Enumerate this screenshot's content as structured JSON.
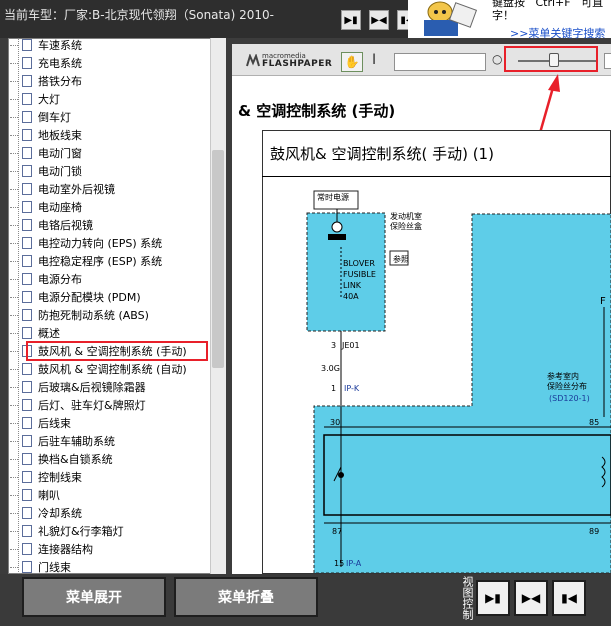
{
  "header": {
    "car_label": "当前车型：厂家:B-北京现代领翔（Sonata) 2010-",
    "nav_buttons": [
      "▶▮",
      "▶◀",
      "▮◀"
    ]
  },
  "notice": {
    "text": "键盘按   Ctrl+F   可直\n字！",
    "link": ">>菜单关键字搜索"
  },
  "tree": {
    "items": [
      "车速系统",
      "充电系统",
      "搭铁分布",
      "大灯",
      "倒车灯",
      "地板线束",
      "电动门窗",
      "电动门锁",
      "电动室外后视镜",
      "电动座椅",
      "电铬后视镜",
      "电控动力转向 (EPS) 系统",
      "电控稳定程序 (ESP) 系统",
      "电源分布",
      "电源分配模块 (PDM)",
      "防抱死制动系统 (ABS)",
      "概述",
      "鼓风机 & 空调控制系统 (手动)",
      "鼓风机 & 空调控制系统 (自动)",
      "后玻璃&后视镜除霜器",
      "后灯、驻车灯&牌照灯",
      "后线束",
      "后驻车辅助系统",
      "换档&自锁系统",
      "控制线束",
      "喇叭",
      "冷却系统",
      "礼貌灯&行李箱灯",
      "连接器结构",
      "门线束"
    ],
    "selected_index": 17
  },
  "viewer": {
    "logo_small": "macromedia",
    "logo_big": "FLASHPAPER",
    "hand_icon": "✋",
    "cursor_icon": "I",
    "zoom_icon": "○",
    "zoom_level": 0.45,
    "doc_heading": "& 空调控制系统 (手动)",
    "diagram_title": "鼓风机& 空调控制系统( 手动) (1)",
    "diagram_labels": {
      "hot_label": "常时电源",
      "engine_box": "发动机室\n保险丝盒",
      "detail": "参照",
      "fuse_name": "BLOVER\nFUSIBLE\nLINK",
      "fuse_amp": "40A",
      "conn1": "3",
      "conn1b": "JE01",
      "wire1": "3.0G",
      "conn2": "1",
      "conn2b": "IP-K",
      "pin30": "30",
      "pin85": "85",
      "pin87": "87",
      "pin89": "89",
      "pin15": "15",
      "pin15b": "IP-A",
      "inner_box": "参考室内\n保险丝分布",
      "inner_ref": "(SD120-1)",
      "right_f": "F"
    }
  },
  "footer": {
    "expand_label": "菜单展开",
    "collapse_label": "菜单折叠",
    "view_control_label": "视图控制",
    "view_buttons": [
      "▶▮",
      "▶◀",
      "▮◀"
    ]
  },
  "colors": {
    "highlight": "#e8202a",
    "diagram_fill": "#5ecde8",
    "link": "#1a4fc9"
  }
}
